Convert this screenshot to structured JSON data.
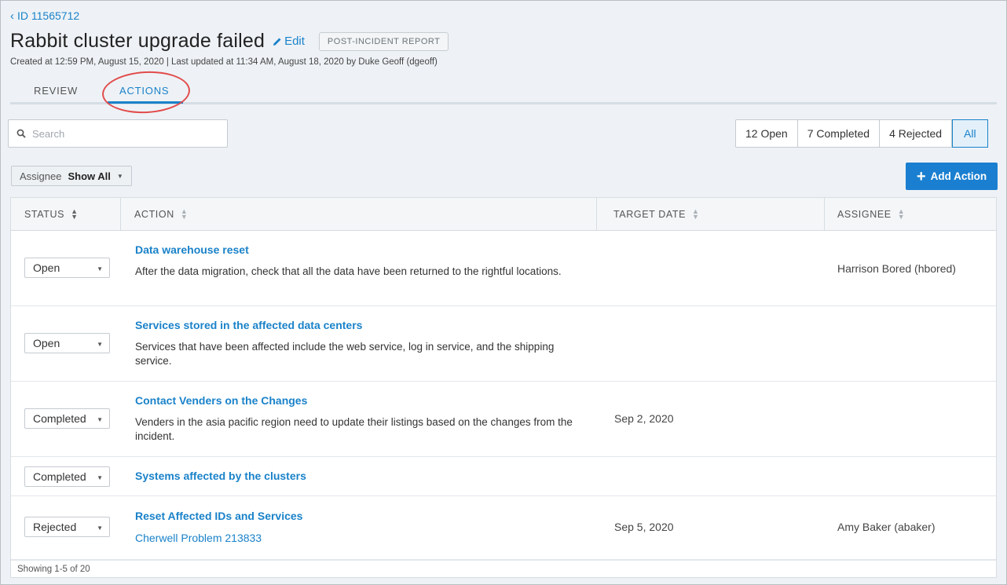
{
  "header": {
    "back_label": "ID 11565712",
    "title": "Rabbit cluster upgrade failed",
    "edit_label": "Edit",
    "badge": "POST-INCIDENT REPORT",
    "meta": "Created at 12:59 PM, August 15, 2020  |  Last updated at 11:34 AM, August 18, 2020 by Duke Geoff (dgeoff)"
  },
  "tabs": [
    {
      "label": "REVIEW",
      "active": false
    },
    {
      "label": "ACTIONS",
      "active": true
    }
  ],
  "search": {
    "placeholder": "Search",
    "value": ""
  },
  "filters": [
    {
      "label": "12 Open",
      "active": false
    },
    {
      "label": "7 Completed",
      "active": false
    },
    {
      "label": "4 Rejected",
      "active": false
    },
    {
      "label": "All",
      "active": true
    }
  ],
  "assignee_filter": {
    "label": "Assignee",
    "value": "Show All"
  },
  "add_action_label": "Add Action",
  "table": {
    "columns": [
      "STATUS",
      "ACTION",
      "TARGET DATE",
      "ASSIGNEE"
    ],
    "rows": [
      {
        "status": "Open",
        "title": "Data warehouse reset",
        "description": "After the data migration, check that all the data have been returned to the rightful locations.",
        "link": "",
        "target_date": "",
        "assignee": "Harrison Bored (hbored)"
      },
      {
        "status": "Open",
        "title": "Services stored in the affected data centers",
        "description": "Services that have been affected include the web service, log in service, and the shipping service.",
        "link": "",
        "target_date": "",
        "assignee": ""
      },
      {
        "status": "Completed",
        "title": "Contact Venders on the Changes",
        "description": "Venders in the asia pacific region need to update their listings based on the changes from the incident.",
        "link": "",
        "target_date": "Sep 2, 2020",
        "assignee": ""
      },
      {
        "status": "Completed",
        "title": "Systems affected by the clusters",
        "description": "",
        "link": "",
        "target_date": "",
        "assignee": ""
      },
      {
        "status": "Rejected",
        "title": "Reset Affected IDs and Services",
        "description": "",
        "link": "Cherwell Problem 213833",
        "target_date": "Sep 5, 2020",
        "assignee": "Amy Baker (abaker)"
      }
    ],
    "footer": "Showing 1-5 of 20"
  },
  "colors": {
    "accent": "#1a82c9",
    "primary_button": "#1a7fd0",
    "annotation_circle": "#e24b4b"
  }
}
